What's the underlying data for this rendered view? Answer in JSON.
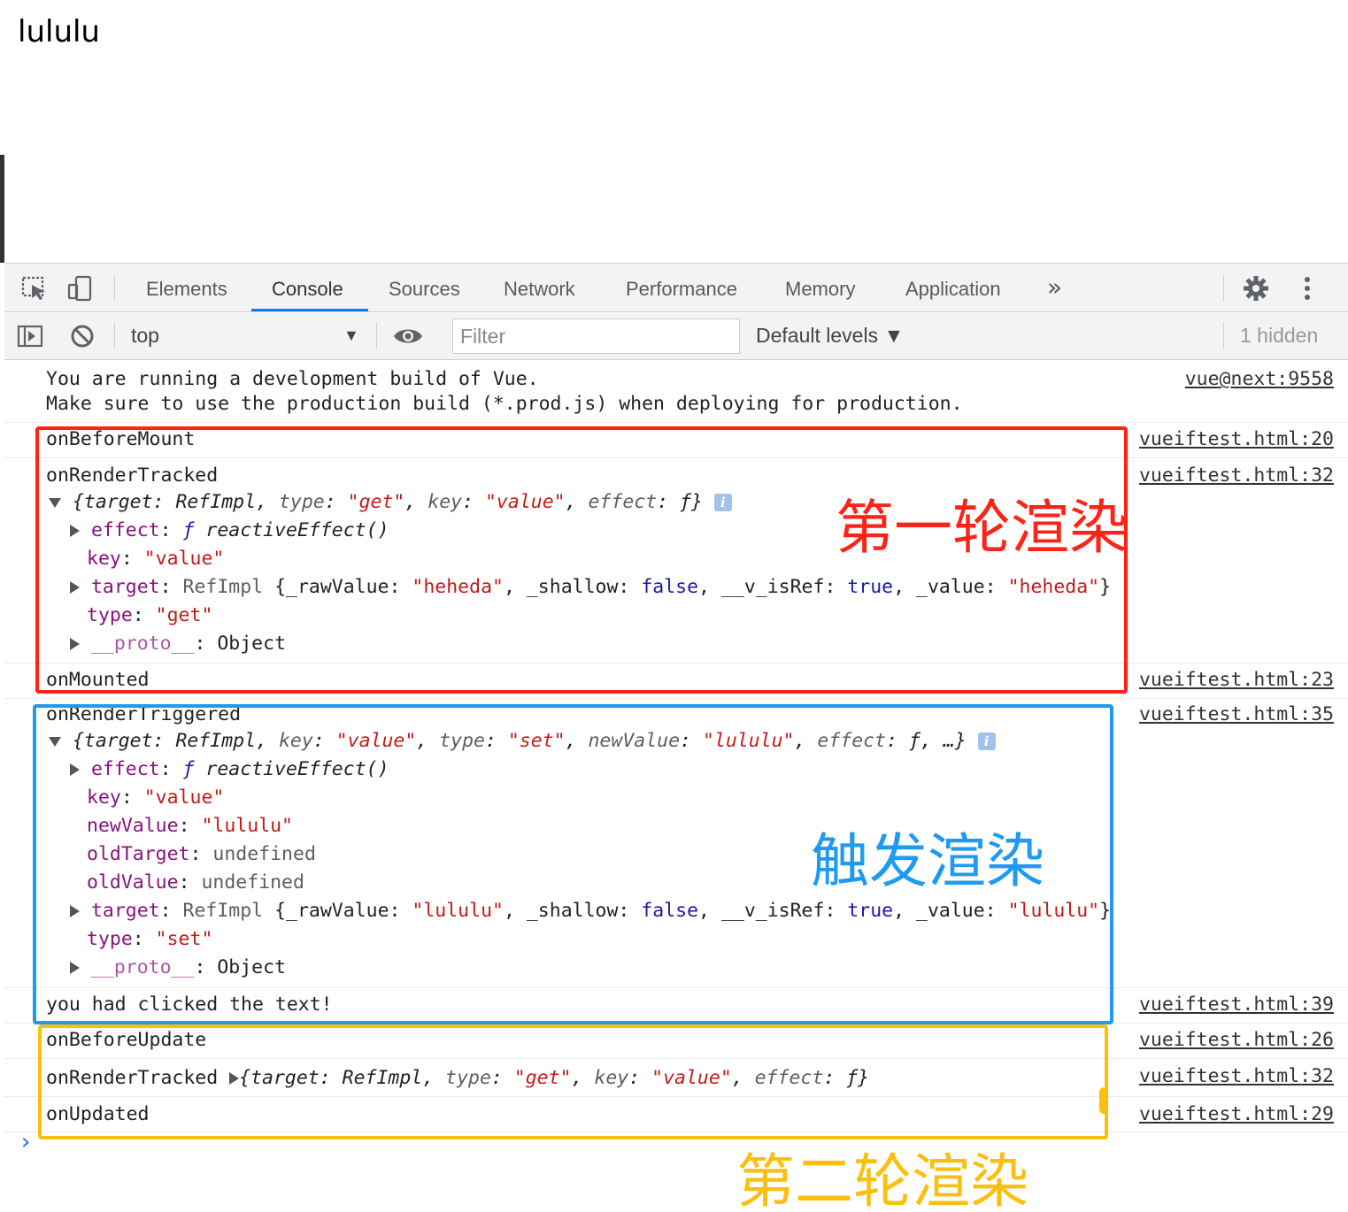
{
  "page": {
    "heading": "lululu"
  },
  "devtools": {
    "tabs": [
      "Elements",
      "Console",
      "Sources",
      "Network",
      "Performance",
      "Memory",
      "Application"
    ],
    "active_tab": "Console",
    "more_tabs_glyph": "»",
    "toolbar": {
      "context": "top",
      "filter_placeholder": "Filter",
      "levels": "Default levels ▼",
      "hidden": "1 hidden"
    }
  },
  "console": {
    "vue_warning": {
      "line1": "You are running a development build of Vue.",
      "line2": "Make sure to use the production build (*.prod.js) when deploying for production.",
      "source": "vue@next:9558"
    },
    "sources": {
      "before_mount": "vueiftest.html:20",
      "render_tracked_1": "vueiftest.html:32",
      "mounted": "vueiftest.html:23",
      "render_triggered": "vueiftest.html:35",
      "clicked": "vueiftest.html:39",
      "before_update": "vueiftest.html:26",
      "render_tracked_2": "vueiftest.html:32",
      "updated": "vueiftest.html:29"
    },
    "messages": {
      "before_mount": "onBeforeMount",
      "render_tracked": "onRenderTracked",
      "mounted": "onMounted",
      "render_triggered": "onRenderTriggered",
      "clicked": "you had clicked the text!",
      "before_update": "onBeforeUpdate",
      "updated": "onUpdated"
    },
    "props": {
      "effect": "effect",
      "f": "ƒ",
      "reactive_effect": "reactiveEffect()",
      "key": "key",
      "target": "target",
      "type": "type",
      "proto": "__proto__",
      "object": "Object",
      "new_value": "newValue",
      "old_target": "oldTarget",
      "old_value": "oldValue",
      "undefined": "undefined",
      "ref_impl": "RefImpl",
      "raw_value": "_rawValue",
      "shallow": "_shallow",
      "is_ref": "__v_isRef",
      "value_field": "_value",
      "false": "false",
      "true": "true",
      "str_get": "\"get\"",
      "str_set": "\"set\"",
      "str_value": "\"value\"",
      "str_heheda": "\"heheda\"",
      "str_lululu": "\"lululu\"",
      "ellipsis": "…"
    }
  },
  "annotations": {
    "first_render": {
      "label": "第一轮渲染",
      "color": "#ff2216"
    },
    "trigger_render": {
      "label": "触发渲染",
      "color": "#1e9af0"
    },
    "second_render": {
      "label": "第二轮渲染",
      "color": "#fbbf10"
    }
  }
}
